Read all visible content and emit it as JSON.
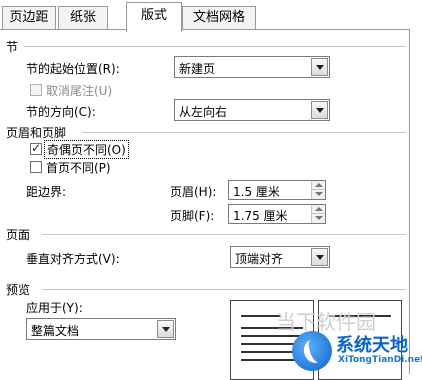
{
  "tabs": [
    "页边距",
    "纸张",
    "版式",
    "文档网格"
  ],
  "section": {
    "title": "节",
    "start_label": "节的起始位置(R):",
    "start_value": "新建页",
    "suppress_endnotes": "取消尾注(U)",
    "direction_label": "节的方向(C):",
    "direction_value": "从左向右"
  },
  "header_footer": {
    "title": "页眉和页脚",
    "odd_even": "奇偶页不同(O)",
    "odd_even_checked": true,
    "first_page": "首页不同(P)",
    "first_page_checked": false,
    "from_edge": "距边界:",
    "header_label": "页眉(H):",
    "header_value": "1.5 厘米",
    "footer_label": "页脚(F):",
    "footer_value": "1.75 厘米"
  },
  "page": {
    "title": "页面",
    "valign_label": "垂直对齐方式(V):",
    "valign_value": "顶端对齐"
  },
  "preview": {
    "title": "预览",
    "apply_label": "应用于(Y):",
    "apply_value": "整篇文档"
  },
  "watermark": {
    "text": "当下软件园",
    "brand": "系统天地",
    "brand_sub": "XiTongTianDi.net"
  }
}
